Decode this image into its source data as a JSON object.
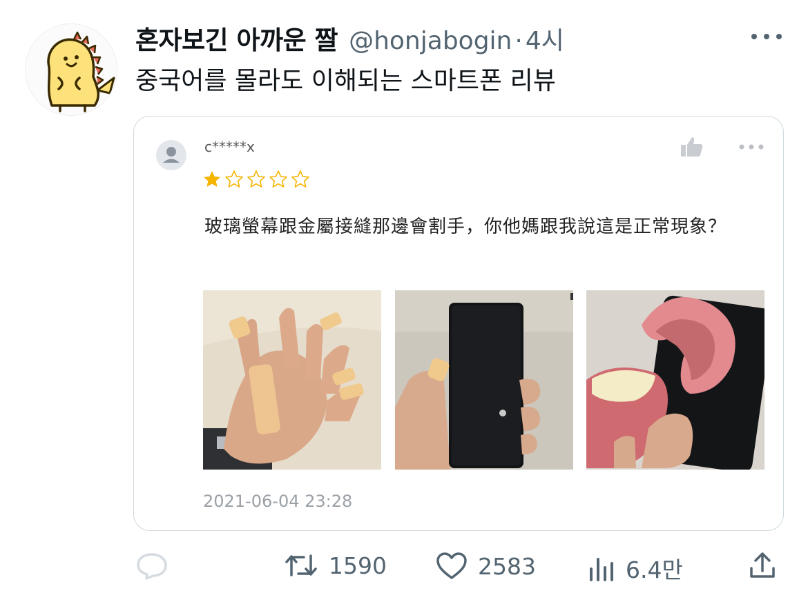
{
  "tweet": {
    "display_name": "혼자보긴 아까운 짤",
    "handle": "@honjabogin",
    "separator": "·",
    "time": "4시",
    "text": "중국어를 몰라도 이해되는 스마트폰 리뷰"
  },
  "review": {
    "username": "c*****x",
    "rating": 1,
    "rating_max": 5,
    "text": "玻璃螢幕跟金屬接縫那邊會割手，你他媽跟我說這是正常現象？",
    "date": "2021-06-04 23:28",
    "photos": [
      "hand-with-bandages-photo",
      "hand-holding-phone-photo",
      "apple-sliced-by-phone-photo"
    ]
  },
  "actions": {
    "reply_count": "",
    "retweet_count": "1590",
    "like_count": "2583",
    "view_count": "6.4만"
  },
  "colors": {
    "muted": "#536471",
    "star": "#f5b400",
    "border": "#cfd9de",
    "avatar_yellow": "#fde17a"
  },
  "icons": [
    "more-icon",
    "thumbs-up-icon",
    "star-icon",
    "reply-icon",
    "retweet-icon",
    "like-icon",
    "views-icon",
    "share-icon"
  ]
}
